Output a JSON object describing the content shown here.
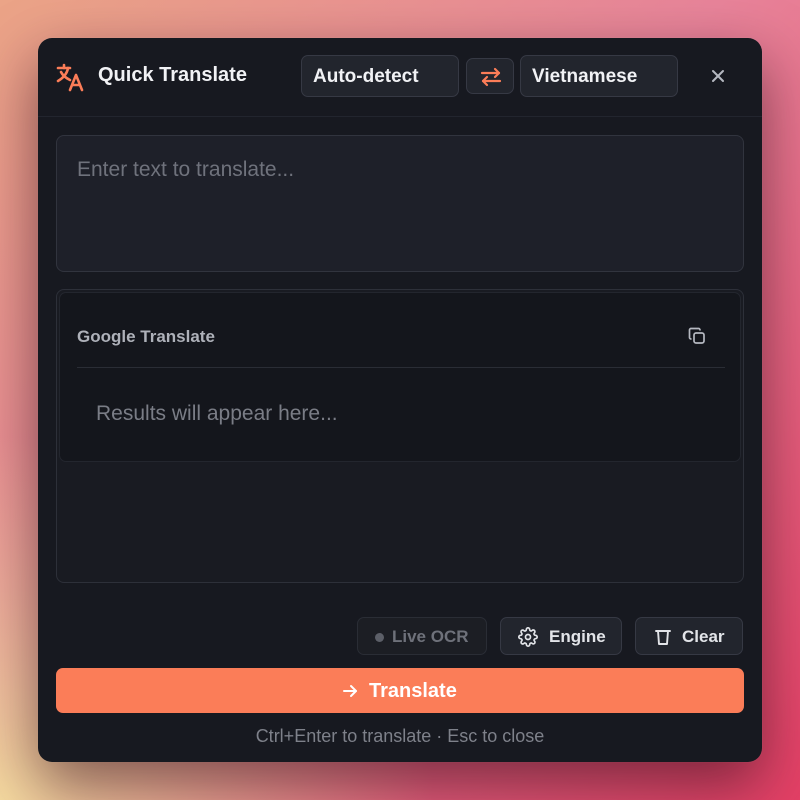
{
  "app": {
    "title": "Quick Translate",
    "icon": "translate-icon",
    "accent_color": "#fb7d58"
  },
  "header": {
    "source_language": "Auto-detect",
    "target_language": "Vietnamese",
    "swap_icon": "swap-arrows-icon",
    "close_icon": "close-icon"
  },
  "input": {
    "placeholder": "Enter text to translate...",
    "value": ""
  },
  "results": {
    "engine_name": "Google Translate",
    "copy_icon": "copy-icon",
    "placeholder": "Results will appear here..."
  },
  "toolbar": {
    "live_ocr_label": "Live OCR",
    "engine_label": "Engine",
    "engine_icon": "gear-icon",
    "clear_label": "Clear",
    "clear_icon": "trash-icon"
  },
  "translate_button": {
    "label": "Translate",
    "icon": "arrow-right-icon"
  },
  "hint": "Ctrl+Enter to translate · Esc to close"
}
